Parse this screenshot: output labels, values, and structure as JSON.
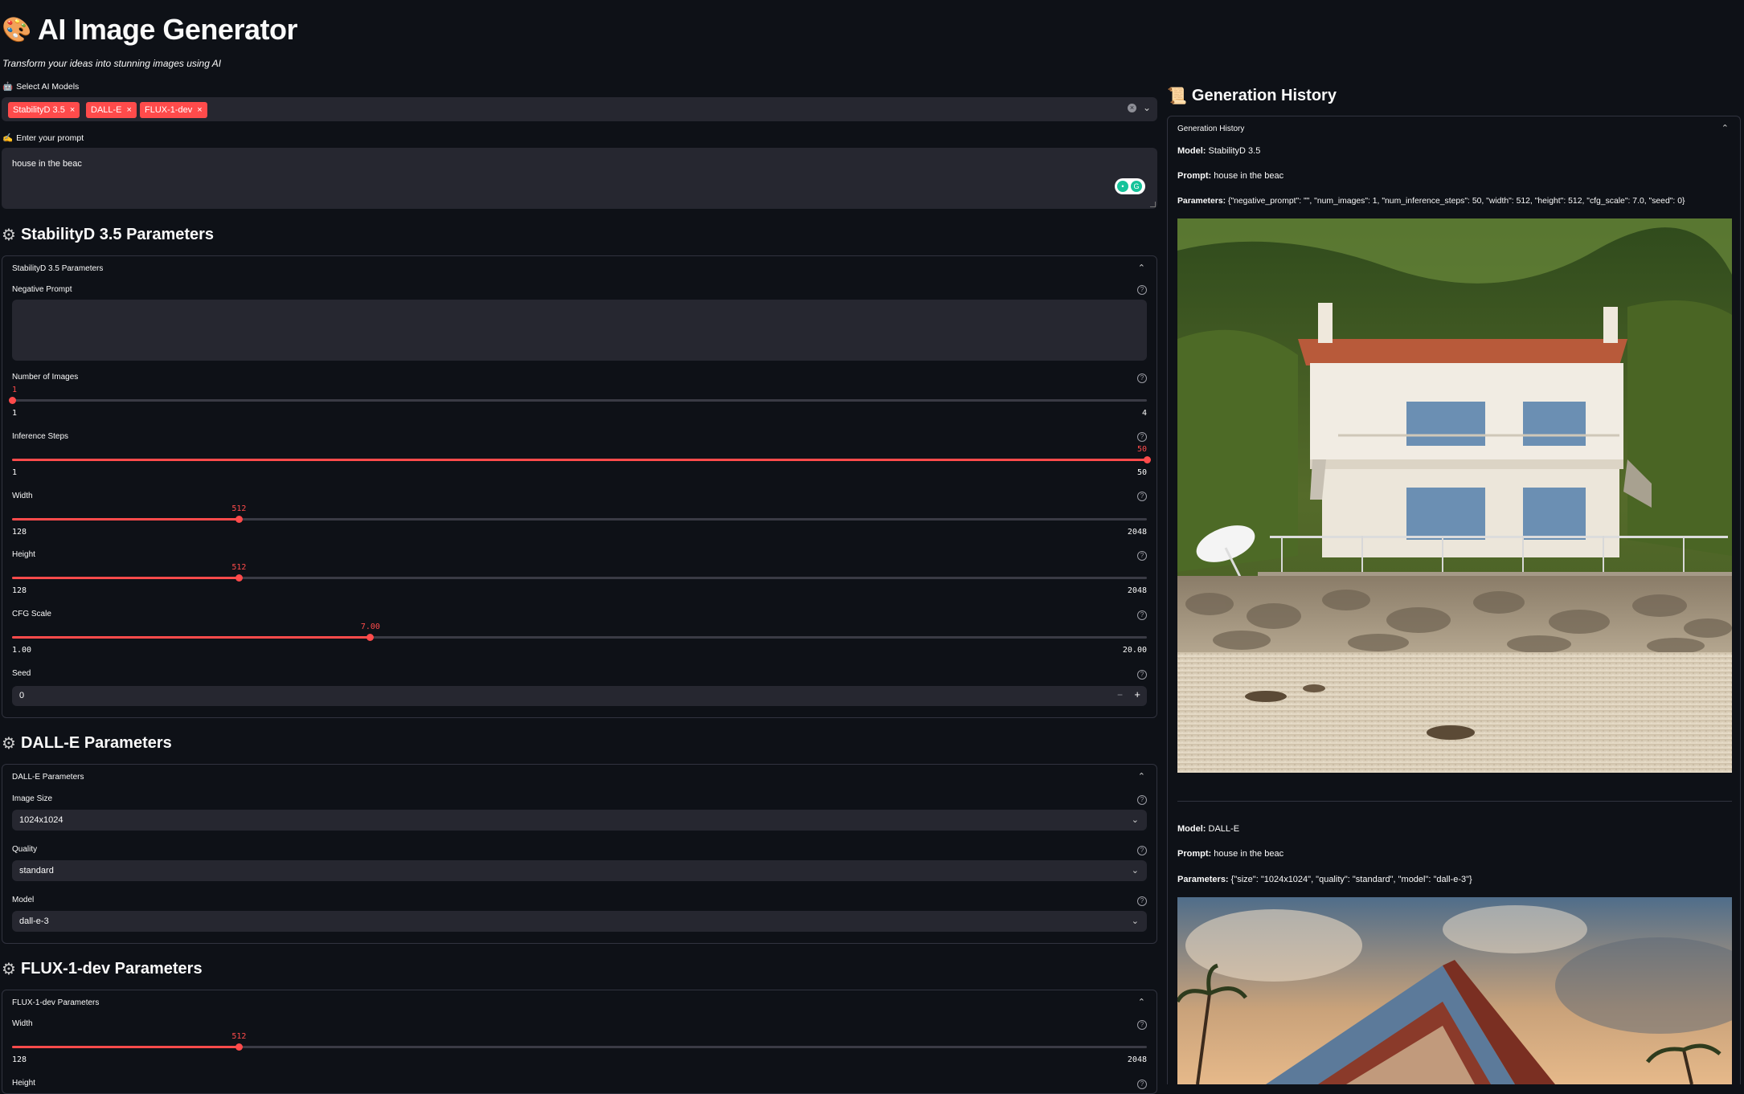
{
  "header": {
    "emoji": "🎨",
    "title": "AI Image Generator",
    "subtitle": "Transform your ideas into stunning images using AI"
  },
  "models": {
    "label_icon": "🤖",
    "label": "Select AI Models",
    "selected": [
      "StabilityD 3.5",
      "DALL-E",
      "FLUX-1-dev"
    ],
    "chip_remove": "×"
  },
  "prompt": {
    "label_icon": "✍️",
    "label": "Enter your prompt",
    "value": "house in the beac"
  },
  "stability": {
    "heading": "StabilityD 3.5 Parameters",
    "expander_title": "StabilityD 3.5 Parameters",
    "negative_prompt_label": "Negative Prompt",
    "num_images": {
      "label": "Number of Images",
      "value": "1",
      "min": "1",
      "max": "4",
      "fraction": 0.0
    },
    "inference_steps": {
      "label": "Inference Steps",
      "value": "50",
      "min": "1",
      "max": "50",
      "fraction": 1.0
    },
    "width": {
      "label": "Width",
      "value": "512",
      "min": "128",
      "max": "2048",
      "fraction": 0.2
    },
    "height": {
      "label": "Height",
      "value": "512",
      "min": "128",
      "max": "2048",
      "fraction": 0.2
    },
    "cfg_scale": {
      "label": "CFG Scale",
      "value": "7.00",
      "min": "1.00",
      "max": "20.00",
      "fraction": 0.3158
    },
    "seed": {
      "label": "Seed",
      "value": "0"
    }
  },
  "dalle": {
    "heading": "DALL-E Parameters",
    "expander_title": "DALL-E Parameters",
    "image_size": {
      "label": "Image Size",
      "value": "1024x1024"
    },
    "quality": {
      "label": "Quality",
      "value": "standard"
    },
    "model": {
      "label": "Model",
      "value": "dall-e-3"
    }
  },
  "flux": {
    "heading": "FLUX-1-dev Parameters",
    "expander_title": "FLUX-1-dev Parameters",
    "width": {
      "label": "Width",
      "value": "512",
      "min": "128",
      "max": "2048",
      "fraction": 0.2
    },
    "height_label": "Height"
  },
  "history": {
    "icon": "📜",
    "heading": "Generation History",
    "expander_title": "Generation History",
    "model_key": "Model:",
    "prompt_key": "Prompt:",
    "params_key": "Parameters:",
    "entries": [
      {
        "model": "StabilityD 3.5",
        "prompt": "house in the beac",
        "params": "{\"negative_prompt\": \"\", \"num_images\": 1, \"num_inference_steps\": 50, \"width\": 512, \"height\": 512, \"cfg_scale\": 7.0, \"seed\": 0}"
      },
      {
        "model": "DALL-E",
        "prompt": "house in the beac",
        "params": "{\"size\": \"1024x1024\", \"quality\": \"standard\", \"model\": \"dall-e-3\"}"
      }
    ]
  },
  "colors": {
    "accent": "#ff4b4b",
    "background": "#0e1117",
    "input_bg": "#262730",
    "border": "#31333f"
  },
  "icons": {
    "settings": "gear-icon",
    "help": "help-circle-icon",
    "expander": "chevron-up-icon",
    "select": "chevron-down-icon"
  }
}
